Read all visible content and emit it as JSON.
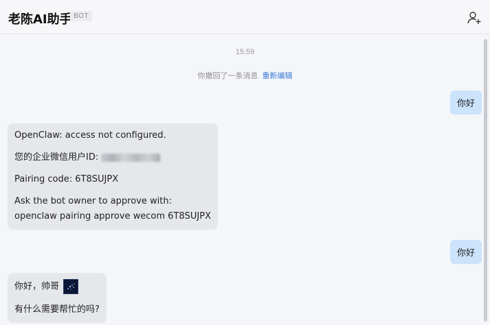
{
  "header": {
    "title": "老陈AI助手",
    "badge": "BOT"
  },
  "chat": {
    "timestamp": "15:59",
    "recall_notice": "你撤回了一条消息",
    "recall_action": "重新编辑",
    "messages": [
      {
        "side": "right",
        "text": "你好"
      },
      {
        "side": "left",
        "lines": [
          "OpenClaw: access not configured.",
          "您的企业微信用户ID:",
          "Pairing code: 6T8SUJPX",
          "Ask the bot owner to approve with:",
          "openclaw pairing approve wecom 6T8SUJPX"
        ]
      },
      {
        "side": "right",
        "text": "你好"
      },
      {
        "side": "left",
        "lines": [
          "你好，帅哥",
          "有什么需要帮忙的吗?"
        ]
      }
    ]
  },
  "icons": {
    "add_member": "add-user-icon",
    "sticker": "sparkle-sticker"
  },
  "colors": {
    "outgoing_bubble": "#cbe3fb",
    "incoming_bubble": "#e5e7eb",
    "link": "#3a7bd5"
  }
}
